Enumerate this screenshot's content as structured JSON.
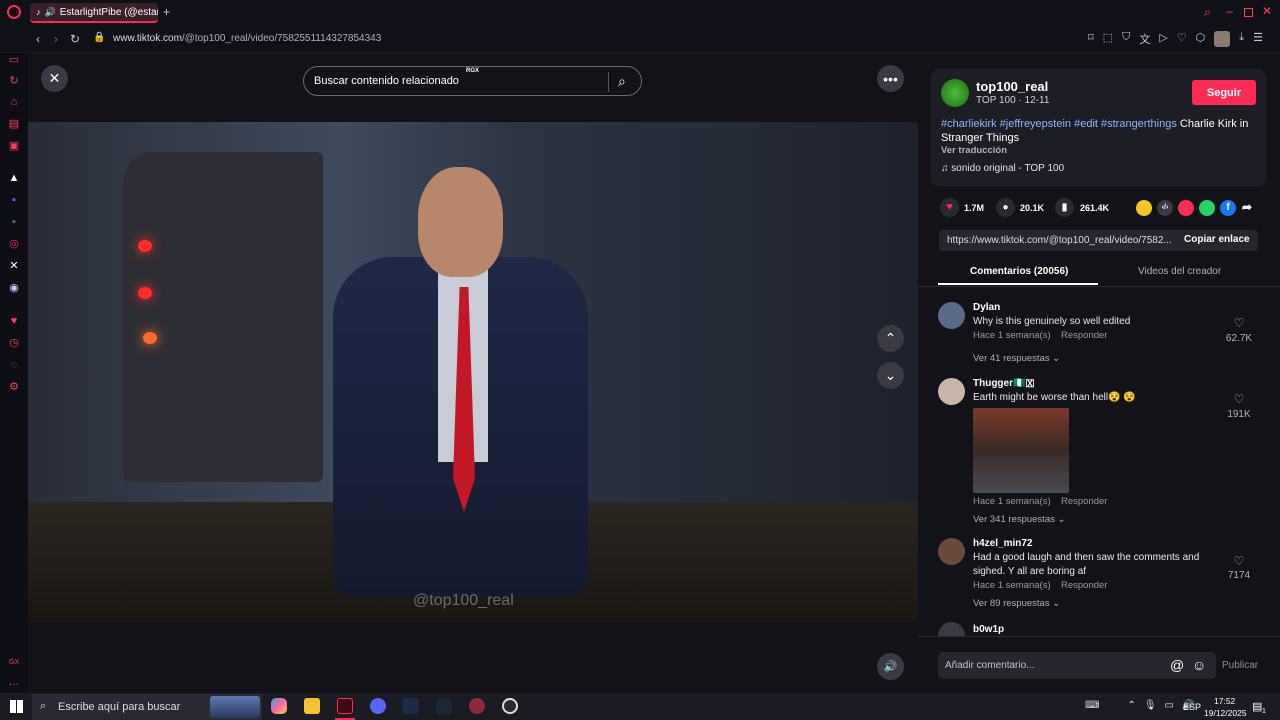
{
  "browser": {
    "tab_title": "EstarlightPibe (@estar",
    "new_tab": "+",
    "url_host": "www.tiktok.com",
    "url_path": "/@top100_real/video/7582551114327854343",
    "window_controls": [
      "minimize",
      "maximize",
      "close"
    ]
  },
  "search": {
    "placeholder": "Buscar contenido relacionado",
    "badge": "RGX"
  },
  "video": {
    "watermark": "@top100_real"
  },
  "creator": {
    "username": "top100_real",
    "subtitle": "TOP 100 · 12-11",
    "follow_label": "Seguir",
    "caption_tags": "#charliekirk #jeffreyepstein #edit #strangerthings",
    "caption_rest": "Charlie Kirk in Stranger Things",
    "translate": "Ver traducción",
    "sound": "sonido original - TOP 100"
  },
  "stats": {
    "likes": "1.7M",
    "comments": "20.1K",
    "saves": "261.4K"
  },
  "share": {
    "link": "https://www.tiktok.com/@top100_real/video/7582...",
    "copy_label": "Copiar enlace"
  },
  "tabs": {
    "comments": "Comentarios (20056)",
    "creator_videos": "Videos del creador"
  },
  "comments": [
    {
      "name": "Dylan",
      "text": "Why is this genuinely so well edited",
      "time": "Hace 1 semana(s)",
      "reply": "Responder",
      "likes": "62.7K",
      "replies": "Ver 41 respuestas"
    },
    {
      "name": "Thugger🇳🇬🇽",
      "text": "Earth might be worse than hell😵 😵",
      "time": "Hace 1 semana(s)",
      "reply": "Responder",
      "likes": "191K",
      "replies": "Ver 341 respuestas"
    },
    {
      "name": "h4zel_min72",
      "text": "Had a good laugh and then saw the comments and sighed. Y all are boring af",
      "time": "Hace 1 semana(s)",
      "reply": "Responder",
      "likes": "7174",
      "replies": "Ver 89 respuestas"
    },
    {
      "name": "b0w1p"
    }
  ],
  "composer": {
    "placeholder": "Añadir comentario...",
    "post_label": "Publicar"
  },
  "taskbar": {
    "search_placeholder": "Escribe aquí para buscar",
    "lang": "ESP",
    "time": "17:52",
    "date": "19/12/2025",
    "notif_count": "1"
  },
  "colors": {
    "accent": "#fe2c55",
    "hashtag": "#8fb3ff"
  }
}
